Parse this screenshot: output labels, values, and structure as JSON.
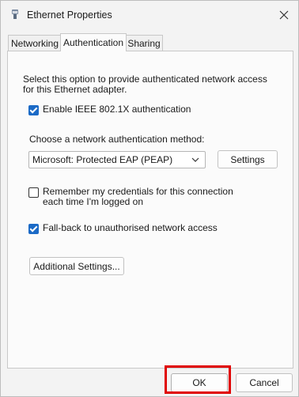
{
  "window": {
    "title": "Ethernet Properties"
  },
  "tabs": [
    {
      "label": "Networking",
      "active": false
    },
    {
      "label": "Authentication",
      "active": true
    },
    {
      "label": "Sharing",
      "active": false
    }
  ],
  "auth": {
    "description": "Select this option to provide authenticated network access for this Ethernet adapter.",
    "enable_8021x": {
      "label": "Enable IEEE 802.1X authentication",
      "checked": true
    },
    "method_label": "Choose a network authentication method:",
    "method_value": "Microsoft: Protected EAP (PEAP)",
    "settings_label": "Settings",
    "remember_credentials": {
      "label": "Remember my credentials for this connection each time I'm logged on",
      "checked": false
    },
    "fallback": {
      "label": "Fall-back to unauthorised network access",
      "checked": true
    },
    "additional_settings_label": "Additional Settings..."
  },
  "footer": {
    "ok_label": "OK",
    "cancel_label": "Cancel"
  },
  "colors": {
    "accent": "#1b6ac6",
    "highlight": "#e00000"
  },
  "icons": [
    "network-adapter-icon",
    "close-icon",
    "chevron-down-icon",
    "checkmark-icon"
  ]
}
